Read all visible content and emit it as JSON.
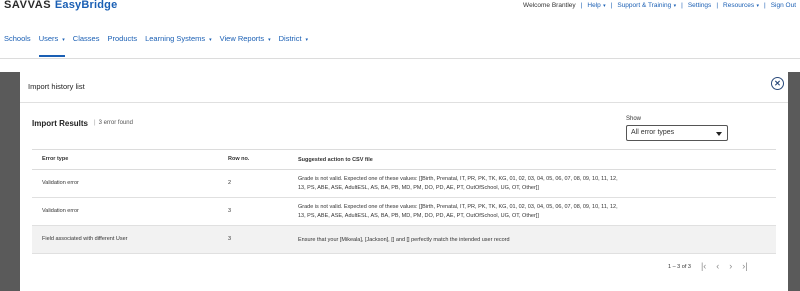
{
  "header": {
    "logo_part1": "SAVVAS",
    "logo_part2": "EasyBridge",
    "welcome": "Welcome Brantley",
    "links": [
      {
        "label": "Help",
        "dropdown": true
      },
      {
        "label": "Support & Training",
        "dropdown": true
      },
      {
        "label": "Settings",
        "dropdown": false
      },
      {
        "label": "Resources",
        "dropdown": true
      },
      {
        "label": "Sign Out",
        "dropdown": false
      }
    ]
  },
  "nav": {
    "items": [
      {
        "label": "Schools"
      },
      {
        "label": "Users"
      },
      {
        "label": "Classes"
      },
      {
        "label": "Products"
      },
      {
        "label": "Learning Systems"
      },
      {
        "label": "View Reports"
      },
      {
        "label": "District"
      }
    ],
    "active": "Users"
  },
  "modal": {
    "title": "Import history list",
    "results_title": "Import Results",
    "results_count": "3 error found",
    "show_label": "Show",
    "show_value": "All error types",
    "table": {
      "headers": [
        "Error type",
        "Row no.",
        "Suggested action to CSV file"
      ],
      "rows": [
        {
          "error_type": "Validation error",
          "row_no": "2",
          "action": "Grade is not valid. Expected one of these values: [[Birth, Prenatal, IT, PR, PK, TK, KG, 01, 02, 03, 04, 05, 06, 07, 08, 09, 10, 11, 12, 13, PS, ABE, ASE, AdultESL, AS, BA, PB, MD, PM, DO, PD, AE, PT, OutOfSchool, UG, OT, Other]]"
        },
        {
          "error_type": "Validation error",
          "row_no": "3",
          "action": "Grade is not valid. Expected one of these values: [[Birth, Prenatal, IT, PR, PK, TK, KG, 01, 02, 03, 04, 05, 06, 07, 08, 09, 10, 11, 12, 13, PS, ABE, ASE, AdultESL, AS, BA, PB, MD, PM, DO, PD, AE, PT, OutOfSchool, UG, OT, Other]]"
        },
        {
          "error_type": "Field associated with different User",
          "row_no": "3",
          "action": "Ensure that your [Mikeala], [Jackson], [] and [] perfectly match the intended user record"
        }
      ]
    },
    "pagination": {
      "summary": "1 – 3 of 3",
      "first_icon": "first-page-icon",
      "prev_icon": "previous-page-icon",
      "next_icon": "next-page-icon",
      "last_icon": "last-page-icon"
    }
  }
}
